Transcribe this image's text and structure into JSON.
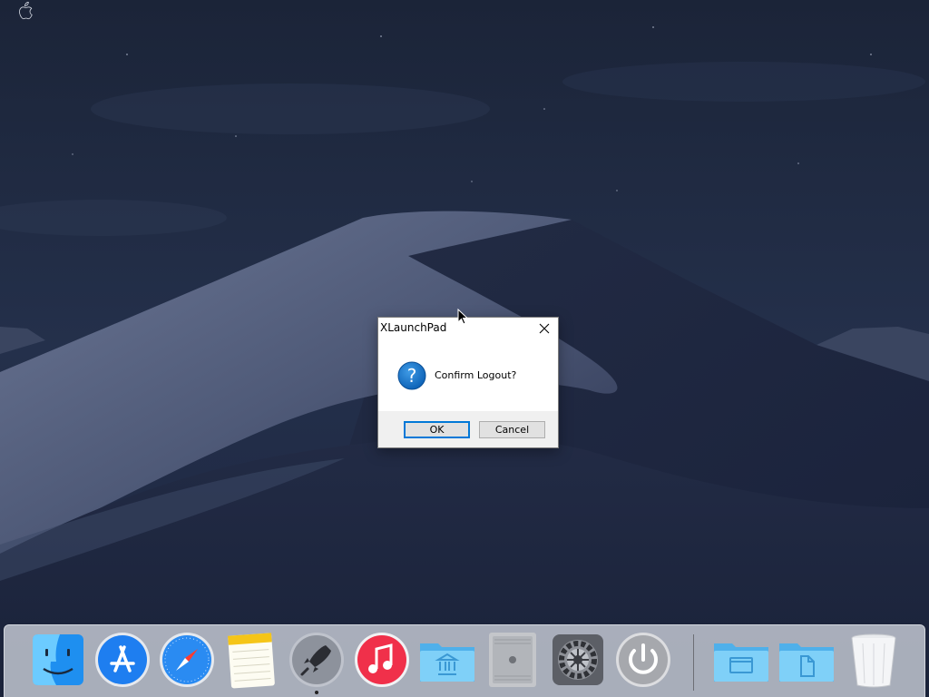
{
  "dialog": {
    "title": "XLaunchPad",
    "message": "Confirm Logout?",
    "ok_label": "OK",
    "cancel_label": "Cancel"
  },
  "dock": {
    "items": [
      {
        "name": "finder",
        "icon": "finder-icon"
      },
      {
        "name": "app-store",
        "icon": "app-store-icon"
      },
      {
        "name": "safari",
        "icon": "safari-icon"
      },
      {
        "name": "notes",
        "icon": "notes-icon"
      },
      {
        "name": "launchpad",
        "icon": "launchpad-rocket-icon",
        "running": true
      },
      {
        "name": "music",
        "icon": "music-icon"
      },
      {
        "name": "applications-folder",
        "icon": "applications-folder-icon"
      },
      {
        "name": "mac-pro",
        "icon": "mac-pro-icon"
      },
      {
        "name": "system-preferences",
        "icon": "gear-icon"
      },
      {
        "name": "power",
        "icon": "power-icon"
      },
      {
        "name": "desktop-folder",
        "icon": "desktop-folder-icon"
      },
      {
        "name": "documents-folder",
        "icon": "documents-folder-icon"
      },
      {
        "name": "trash",
        "icon": "trash-icon"
      }
    ]
  },
  "colors": {
    "accent": "#0078d7",
    "dock_bg": "#c8cdd7",
    "folder": "#6ec0f0"
  }
}
